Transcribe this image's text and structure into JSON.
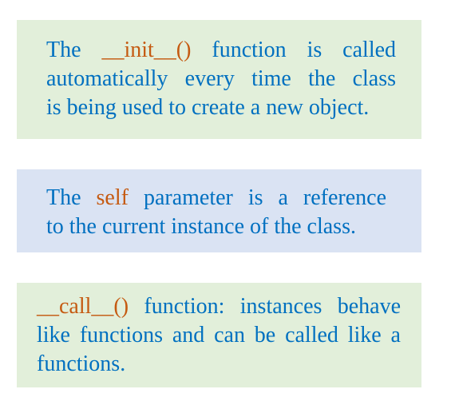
{
  "colors": {
    "text": "#0070c0",
    "highlight": "#c55a11",
    "green_box": "#e2efda",
    "blue_box": "#dae3f3"
  },
  "box1": {
    "l1a": "The",
    "l1b": "__init__()",
    "l1c": "function is called",
    "l2": "automatically every time the class",
    "l3": "is being used to create a new object."
  },
  "box2": {
    "l1a": "The",
    "l1b": "self",
    "l1c": "parameter is a reference",
    "l2": "to the current instance of the class."
  },
  "box3": {
    "l1a": "__call__()",
    "l1b": "function: instances behave",
    "l2": "like functions and can be called like a",
    "l3": "functions."
  }
}
